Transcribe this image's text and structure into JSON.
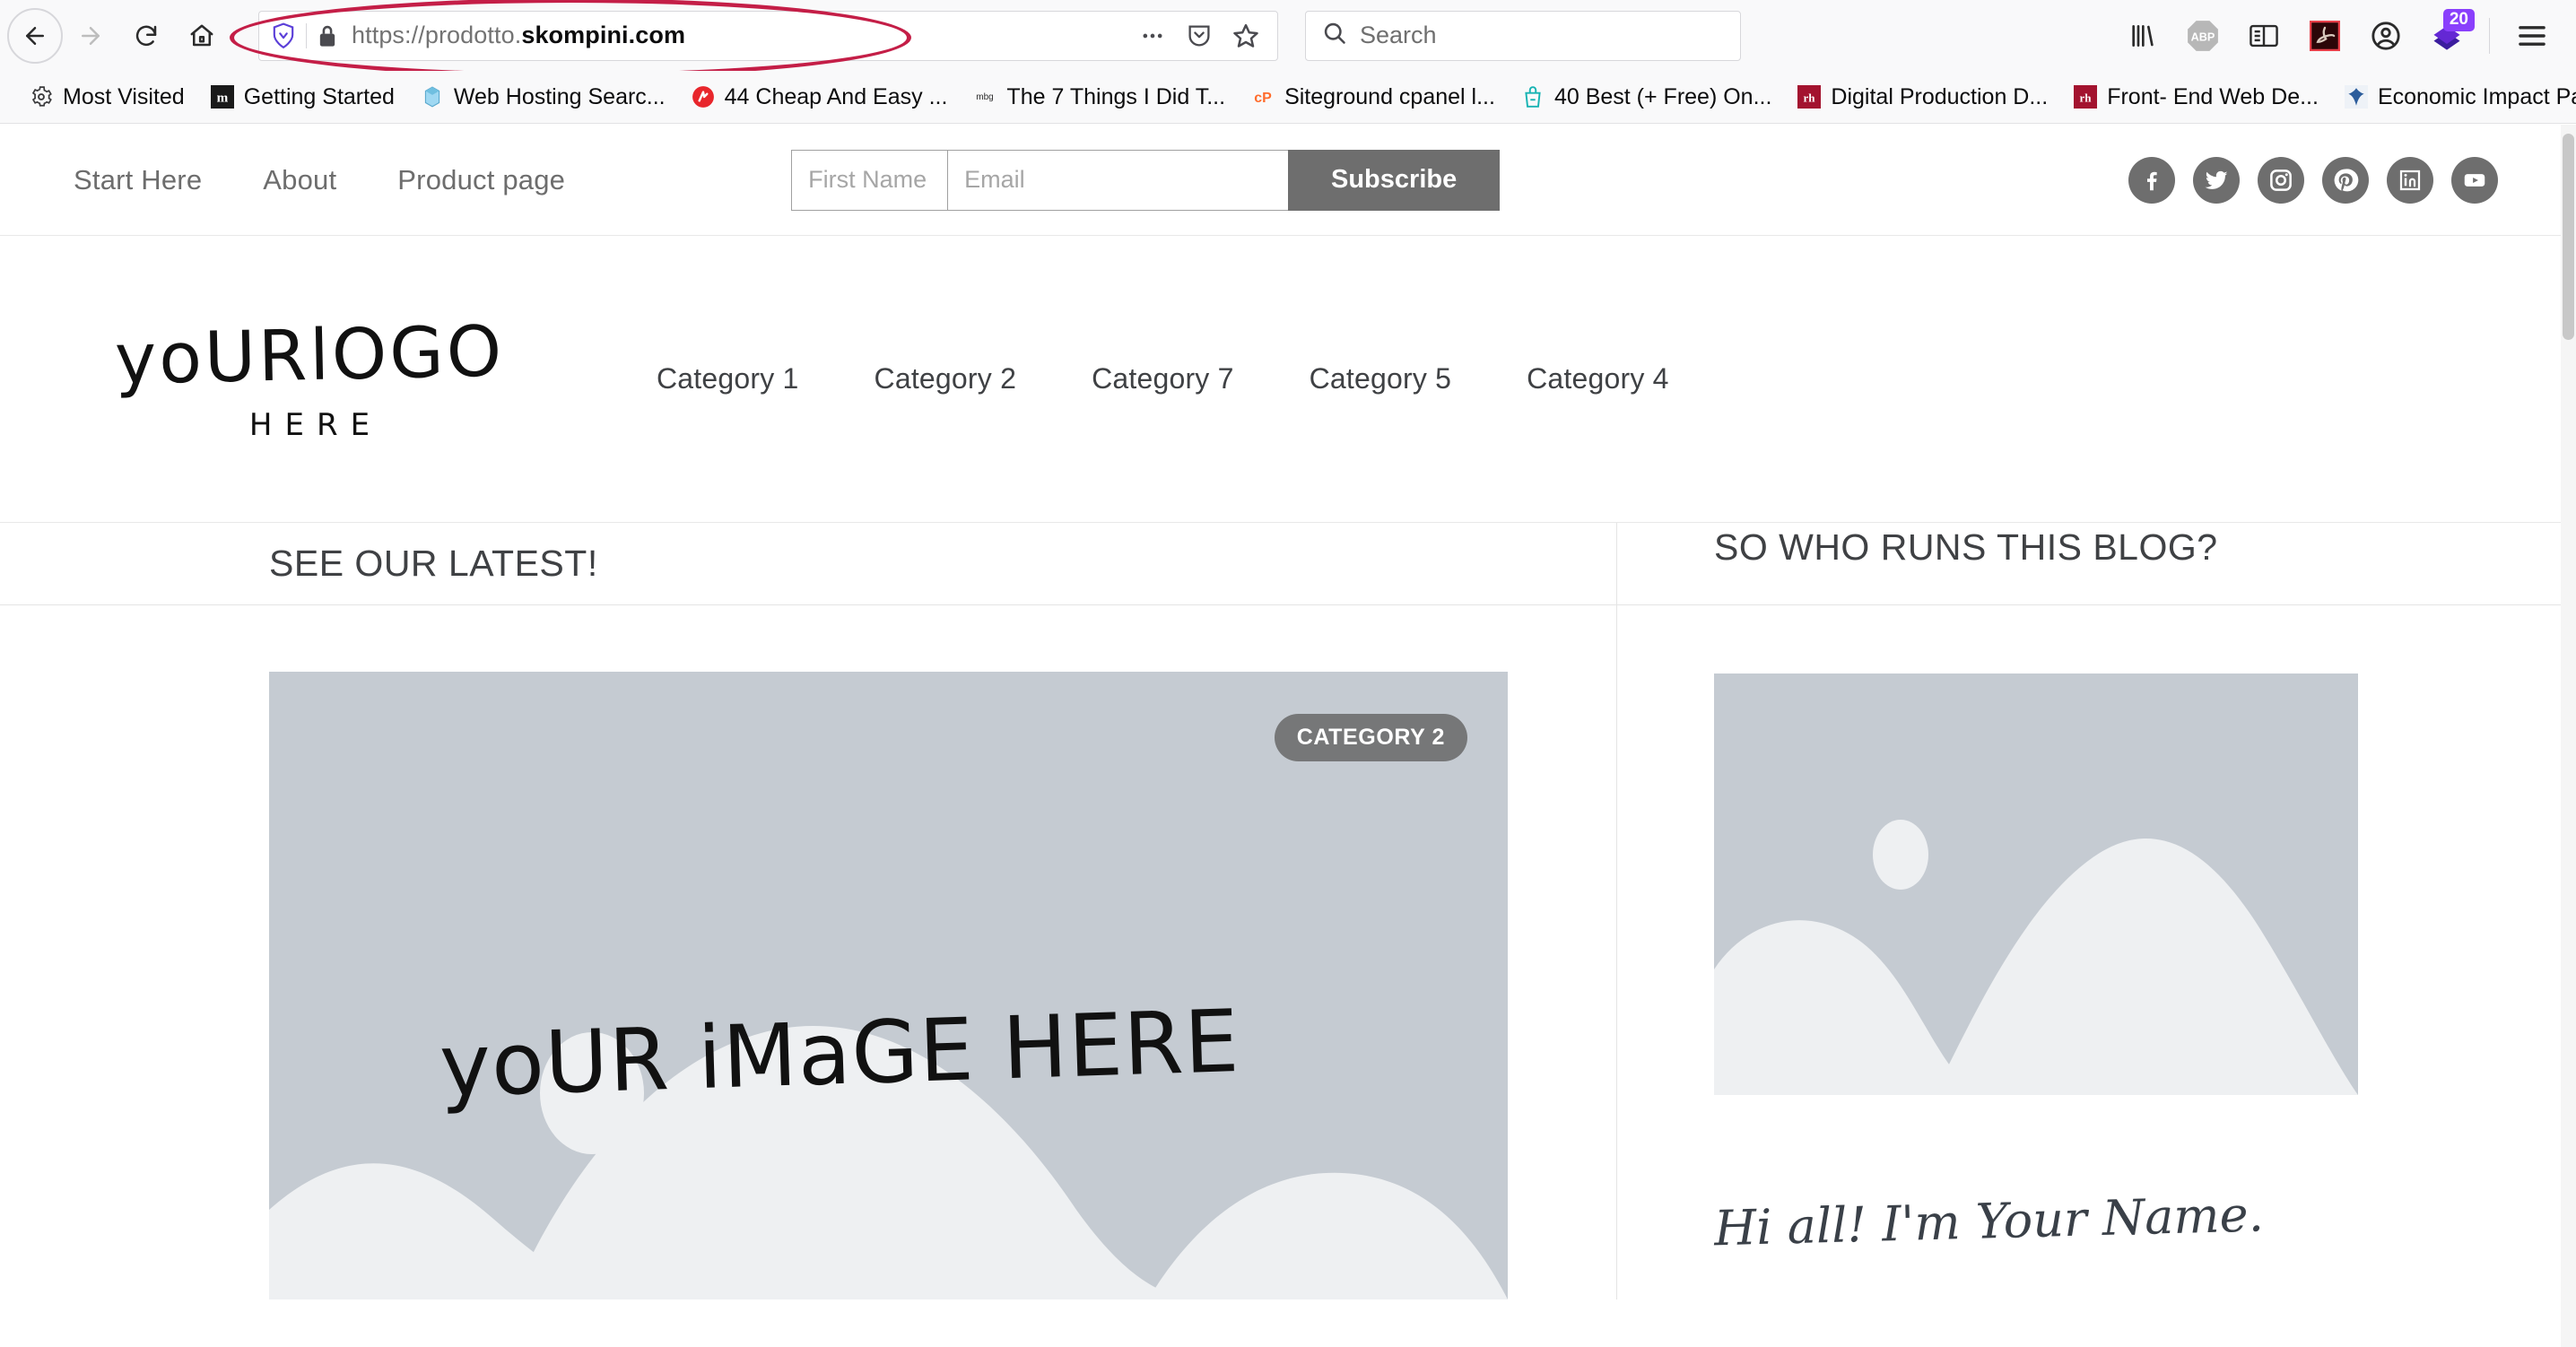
{
  "browser": {
    "nav": {
      "back_icon": "back-arrow-icon",
      "forward_icon": "forward-arrow-icon",
      "reload_icon": "reload-icon",
      "home_icon": "home-icon"
    },
    "url": {
      "protocol_host_dim": "https://prodotto.",
      "host_strong": "skompini.com",
      "shield_icon": "tracking-protection-shield-icon",
      "lock_icon": "padlock-secure-icon",
      "page_actions_icon": "page-actions-ellipsis-icon",
      "pocket_icon": "pocket-icon",
      "bookmark_icon": "bookmark-star-icon",
      "annotation_color": "#c41e47"
    },
    "search": {
      "placeholder": "Search",
      "icon": "magnifier-search-icon",
      "value": ""
    },
    "toolbar_icons": [
      {
        "name": "library-icon",
        "label": "Library"
      },
      {
        "name": "adblock-plus-icon",
        "label": "ABP"
      },
      {
        "name": "reader-view-icon",
        "label": "Reader View"
      },
      {
        "name": "adobe-acrobat-icon",
        "label": "Adobe Acrobat"
      },
      {
        "name": "account-avatar-icon",
        "label": "Account"
      },
      {
        "name": "downloads-icon",
        "label": "Downloads",
        "badge": "20",
        "badge_color": "#8a3ffc"
      },
      {
        "name": "hamburger-menu-icon",
        "label": "Open Menu"
      }
    ]
  },
  "bookmarks": {
    "items": [
      {
        "label": "Most Visited",
        "icon": "gear-icon"
      },
      {
        "label": "Getting Started",
        "icon": "mozilla-m-icon"
      },
      {
        "label": "Web Hosting Searc...",
        "icon": "blue-box-icon"
      },
      {
        "label": "44 Cheap And Easy ...",
        "icon": "red-circle-icon"
      },
      {
        "label": "The 7 Things I Did T...",
        "icon": "mbg-icon"
      },
      {
        "label": "Siteground cpanel l...",
        "icon": "cpanel-icon"
      },
      {
        "label": "40 Best (+ Free) On...",
        "icon": "teal-bag-icon"
      },
      {
        "label": "Digital Production D...",
        "icon": "rh-icon"
      },
      {
        "label": "Front- End Web De...",
        "icon": "rh-icon"
      },
      {
        "label": "Economic Impact Pa...",
        "icon": "irs-eagle-icon"
      }
    ],
    "overflow_icon": "double-chevron-right-icon"
  },
  "site": {
    "top_nav": [
      {
        "label": "Start Here"
      },
      {
        "label": "About"
      },
      {
        "label": "Product page"
      }
    ],
    "subscribe": {
      "first_name_placeholder": "First Name",
      "first_name_value": "",
      "email_placeholder": "Email",
      "email_value": "",
      "button_label": "Subscribe",
      "button_color": "#6e6e6e"
    },
    "socials": [
      {
        "name": "facebook-icon"
      },
      {
        "name": "twitter-icon"
      },
      {
        "name": "instagram-icon"
      },
      {
        "name": "pinterest-icon"
      },
      {
        "name": "linkedin-icon"
      },
      {
        "name": "youtube-icon"
      }
    ],
    "logo": {
      "main": "yoURlOGO",
      "sub": "HERE"
    },
    "category_nav": [
      {
        "label": "Category 1"
      },
      {
        "label": "Category 2"
      },
      {
        "label": "Category 7"
      },
      {
        "label": "Category 5"
      },
      {
        "label": "Category 4"
      }
    ],
    "sections": {
      "latest_title": "SEE OUR LATEST!",
      "about_title": "SO WHO RUNS THIS BLOG?"
    },
    "hero": {
      "badge": "CATEGORY 2",
      "placeholder_text": "yoUR iMaGE HERE",
      "placeholder_bg": "#c5cbd2",
      "placeholder_shape": "#eef0f2"
    },
    "sidebar": {
      "image_placeholder_name": "author-photo-placeholder",
      "intro_text": "Hi all! I'm Your Name."
    }
  }
}
